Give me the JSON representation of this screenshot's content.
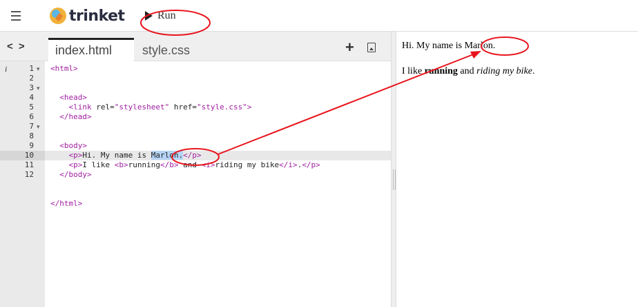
{
  "header": {
    "logo_text": "trinket",
    "run_label": "Run"
  },
  "editor": {
    "tabs": [
      {
        "label": "index.html",
        "active": true
      },
      {
        "label": "style.css",
        "active": false
      }
    ],
    "lines": [
      {
        "num": "1",
        "fold": "▾"
      },
      {
        "num": "2",
        "fold": ""
      },
      {
        "num": "3",
        "fold": "▾"
      },
      {
        "num": "4",
        "fold": ""
      },
      {
        "num": "5",
        "fold": ""
      },
      {
        "num": "6",
        "fold": ""
      },
      {
        "num": "7",
        "fold": "▾"
      },
      {
        "num": "8",
        "fold": ""
      },
      {
        "num": "9",
        "fold": ""
      },
      {
        "num": "10",
        "fold": ""
      },
      {
        "num": "11",
        "fold": ""
      },
      {
        "num": "12",
        "fold": ""
      }
    ],
    "code": {
      "l1": "<html>",
      "l3": "<head>",
      "l4_open": "<link",
      "l4_attr1": " rel=",
      "l4_val1": "\"stylesheet\"",
      "l4_attr2": " href=",
      "l4_val2": "\"style.css\"",
      "l4_close": ">",
      "l5": "</head>",
      "l7": "<body>",
      "l8_open": "<p>",
      "l8_text": "Hi. My name is ",
      "l8_sel": "Marlon.",
      "l8_close": "</p>",
      "l9_open": "<p>",
      "l9_text1": "I like ",
      "l9_b_open": "<b>",
      "l9_b_text": "running",
      "l9_b_close": "</b>",
      "l9_text2": " and ",
      "l9_i_open": "<i>",
      "l9_i_text": "riding my bike",
      "l9_i_close": "</i>",
      "l9_text3": ".",
      "l9_close": "</p>",
      "l10": "</body>",
      "l12": "</html>"
    },
    "active_line": 8
  },
  "preview": {
    "line1_text": "Hi. My name is ",
    "line1_name": "Marlon.",
    "line2_a": "I like ",
    "line2_b": "running",
    "line2_c": " and ",
    "line2_i": "riding my bike",
    "line2_d": "."
  },
  "colors": {
    "annotation": "#e8141c",
    "tag": "#a020a0",
    "selection": "#b5d3f5"
  }
}
